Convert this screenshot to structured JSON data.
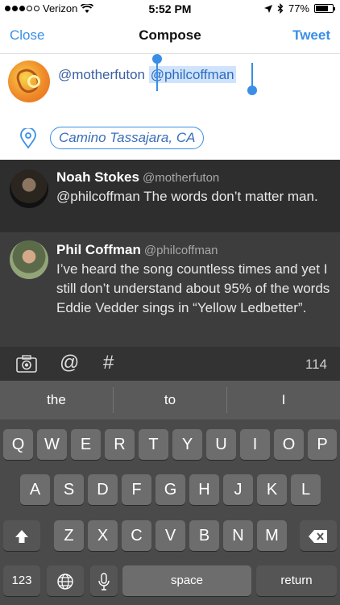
{
  "status": {
    "carrier": "Verizon",
    "time": "5:52 PM",
    "battery_pct": "77%",
    "battery_level": 0.77
  },
  "nav": {
    "close": "Close",
    "title": "Compose",
    "tweet": "Tweet"
  },
  "compose": {
    "mention_plain": "@motherfuton",
    "mention_selected": "@philcoffman",
    "location": "Camino Tassajara, CA"
  },
  "timeline": [
    {
      "name": "Noah Stokes",
      "handle": "@motherfuton",
      "text": "@philcoffman The words don’t matter man."
    },
    {
      "name": "Phil Coffman",
      "handle": "@philcoffman",
      "text": "I’ve heard the song countless times and yet I still don’t understand about 95% of the words Eddie Vedder sings in “Yellow Ledbetter”."
    }
  ],
  "accessory": {
    "char_count": "114",
    "hash": "#",
    "at": "@"
  },
  "suggestions": [
    "the",
    "to",
    "I"
  ],
  "keyboard": {
    "row1": [
      "Q",
      "W",
      "E",
      "R",
      "T",
      "Y",
      "U",
      "I",
      "O",
      "P"
    ],
    "row2": [
      "A",
      "S",
      "D",
      "F",
      "G",
      "H",
      "J",
      "K",
      "L"
    ],
    "row3": [
      "Z",
      "X",
      "C",
      "V",
      "B",
      "N",
      "M"
    ],
    "numbers": "123",
    "space": "space",
    "return": "return"
  },
  "icons": {
    "camera": "camera-icon",
    "location": "location-pin-icon",
    "shift": "shift-icon",
    "delete": "delete-icon",
    "globe": "globe-icon",
    "mic": "microphone-icon"
  },
  "colors": {
    "accent": "#3a8ee6",
    "timeline_bg": "#3a3a3a",
    "keyboard_bg": "#4a4a4a"
  }
}
